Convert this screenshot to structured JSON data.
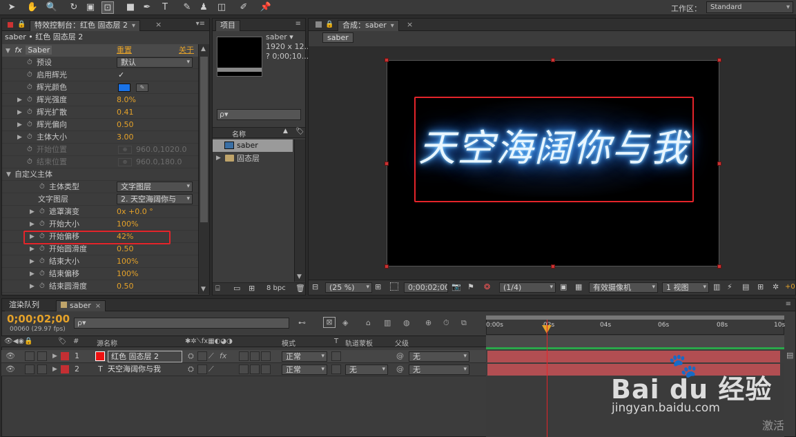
{
  "toolbar": {
    "workspace_label": "工作区：",
    "workspace_value": "Standard"
  },
  "effects_panel": {
    "tab": "特效控制台：红色 固态层 2",
    "breadcrumb": "saber • 红色 固态层 2",
    "fx_label": "fx",
    "effect_name": "Saber",
    "reset": "重置",
    "about": "关于",
    "rows": [
      {
        "label": "预设",
        "value": "默认"
      },
      {
        "label": "启用辉光",
        "value": "✓"
      },
      {
        "label": "辉光颜色",
        "value": ""
      },
      {
        "label": "辉光强度",
        "value": "8.0%"
      },
      {
        "label": "辉光扩散",
        "value": "0.41"
      },
      {
        "label": "辉光偏向",
        "value": "0.50"
      },
      {
        "label": "主体大小",
        "value": "3.00"
      },
      {
        "label": "开始位置",
        "value": "960.0,1020.0"
      },
      {
        "label": "结束位置",
        "value": "960.0,180.0"
      },
      {
        "label": "自定义主体",
        "value": ""
      },
      {
        "label": "主体类型",
        "value": "文字图层"
      },
      {
        "label": "文字图层",
        "value": "2. 天空海阔你与"
      },
      {
        "label": "遮罩演变",
        "value": "0x +0.0 °"
      },
      {
        "label": "开始大小",
        "value": "100%"
      },
      {
        "label": "开始偏移",
        "value": "42%"
      },
      {
        "label": "开始圆滑度",
        "value": "0.50"
      },
      {
        "label": "结束大小",
        "value": "100%"
      },
      {
        "label": "结束偏移",
        "value": "100%"
      },
      {
        "label": "结束圆滑度",
        "value": "0.50"
      }
    ]
  },
  "project_panel": {
    "tab": "项目",
    "comp_name": "saber ▾",
    "comp_info1": "1920 x 12...",
    "comp_info2": "? 0;00;10...",
    "search_placeholder": "ρ▾",
    "col_name": "名称",
    "items": [
      {
        "name": "saber"
      },
      {
        "name": "固态层"
      }
    ],
    "bpc": "8 bpc"
  },
  "comp_panel": {
    "tab": "合成：saber",
    "subtab": "saber",
    "preview_text": "天空海阔你与我",
    "zoom": "(25 %)",
    "timecode": "0;00;02;00",
    "resolution": "(1/4)",
    "camera": "有效摄像机",
    "views": "1 视图",
    "exposure": "+0"
  },
  "timeline": {
    "tab_render": "渲染队列",
    "tab_comp": "saber",
    "timecode": "0;00;02;00",
    "fps": "00060 (29.97 fps)",
    "search_placeholder": "ρ▾",
    "col_hash": "#",
    "col_source": "源名称",
    "col_mode": "模式",
    "col_t": "T",
    "col_trkmat": "轨道蒙板",
    "col_parent": "父级",
    "ticks": [
      "0:00s",
      "02s",
      "04s",
      "06s",
      "08s",
      "10s"
    ],
    "layers": [
      {
        "num": "1",
        "name": "红色 固态层 2",
        "mode": "正常",
        "trkmat": "",
        "parent": "无"
      },
      {
        "num": "2",
        "name": "天空海阔你与我",
        "mode": "正常",
        "trkmat": "无",
        "parent": "无"
      }
    ]
  },
  "watermark": {
    "brand": "Bai du 经验",
    "url": "jingyan.baidu.com",
    "activate": "激活"
  },
  "colors": {
    "accent": "#e5a229",
    "highlight": "#e5242a",
    "glow": "#4fb3ff",
    "layer_red": "#c42f33",
    "swatch": "#1a73e8"
  }
}
